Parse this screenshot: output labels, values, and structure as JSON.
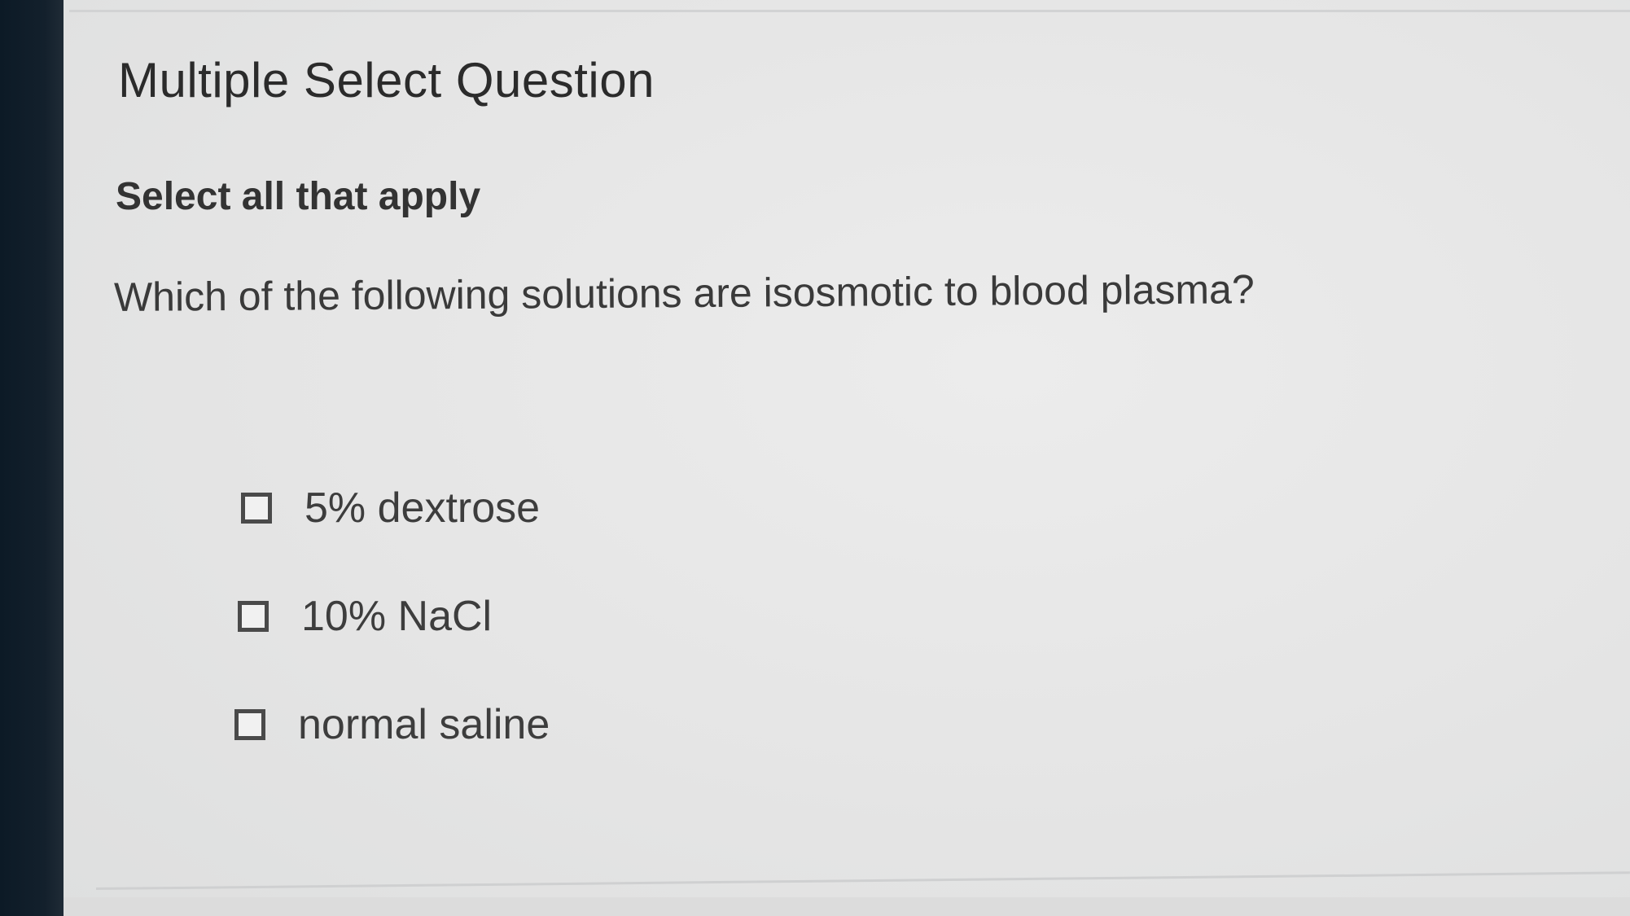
{
  "question_card": {
    "heading": "Multiple Select Question",
    "instruction": "Select all that apply",
    "question": "Which of the following solutions are isosmotic to blood plasma?",
    "options": [
      {
        "label": "5% dextrose",
        "checked": false
      },
      {
        "label": "10% NaCl",
        "checked": false
      },
      {
        "label": "normal saline",
        "checked": false
      }
    ]
  },
  "colors": {
    "panel_background": "#e6e7e8",
    "left_bezel": "#0c1a26",
    "text": "#333333"
  }
}
